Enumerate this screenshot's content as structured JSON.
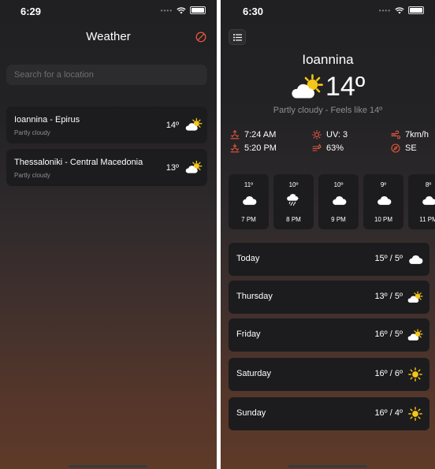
{
  "left": {
    "status_time": "6:29",
    "title": "Weather",
    "search_placeholder": "Search for a location",
    "locations": [
      {
        "name": "Ioannina - Epirus",
        "condition": "Partly cloudy",
        "temp": "14º",
        "icon": "partly-cloudy-icon"
      },
      {
        "name": "Thessaloniki - Central Macedonia",
        "condition": "Partly cloudy",
        "temp": "13º",
        "icon": "partly-cloudy-icon"
      }
    ]
  },
  "right": {
    "status_time": "6:30",
    "city": "Ioannina",
    "temp": "14º",
    "description": "Partly cloudy - Feels like 14º",
    "stats": {
      "sunrise": "7:24 AM",
      "uv": "UV: 3",
      "wind_speed": "7km/h",
      "sunset": "5:20 PM",
      "humidity": "63%",
      "wind_dir": "SE"
    },
    "hourly": [
      {
        "temp": "11º",
        "time": "7 PM",
        "icon": "cloud-icon"
      },
      {
        "temp": "10º",
        "time": "8 PM",
        "icon": "cloud-moon-rain-icon"
      },
      {
        "temp": "10º",
        "time": "9 PM",
        "icon": "cloud-icon"
      },
      {
        "temp": "9º",
        "time": "10 PM",
        "icon": "cloud-icon"
      },
      {
        "temp": "8º",
        "time": "11 PM",
        "icon": "cloud-icon"
      }
    ],
    "daily": [
      {
        "day": "Today",
        "range": "15º / 5º",
        "icon": "cloud-icon"
      },
      {
        "day": "Thursday",
        "range": "13º / 5º",
        "icon": "partly-cloudy-icon"
      },
      {
        "day": "Friday",
        "range": "16º / 5º",
        "icon": "partly-cloudy-icon"
      },
      {
        "day": "Saturday",
        "range": "16º / 6º",
        "icon": "sun-icon"
      },
      {
        "day": "Sunday",
        "range": "16º / 4º",
        "icon": "sun-icon"
      }
    ]
  },
  "colors": {
    "accent": "#e0573e",
    "card": "#1c1c1e",
    "sun": "#f5c518",
    "muted": "#8e8e93"
  }
}
